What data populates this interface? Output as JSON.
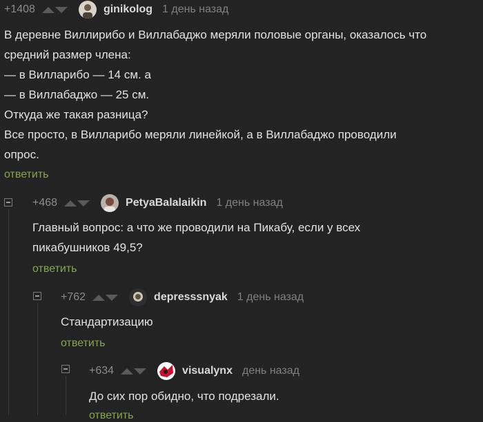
{
  "comments": [
    {
      "rating": "+1408",
      "author": "ginikolog",
      "time": "1 день назад",
      "lines": [
        "В деревне Виллирибо и Виллабаджо меряли половые органы, оказалось что",
        "средний размер члена:",
        "— в Вилларибо — 14 см. а",
        "— в Виллабаджо — 25 см.",
        "Откуда же такая разница?",
        "Все просто, в Вилларибо меряли линейкой, а в Виллабаджо проводили",
        "опрос."
      ],
      "reply": "ответить"
    },
    {
      "rating": "+468",
      "author": "PetyaBalalaikin",
      "time": "1 день назад",
      "lines": [
        "Главный вопрос: а что же проводили на Пикабу, если у всех",
        "пикабушников 49,5?"
      ],
      "reply": "ответить"
    },
    {
      "rating": "+762",
      "author": "depresssnyak",
      "time": "1 день назад",
      "lines": [
        "Стандартизацию"
      ],
      "reply": "ответить"
    },
    {
      "rating": "+634",
      "author": "visualynx",
      "time": "день назад",
      "lines": [
        "До сих пор обидно, что подрезали."
      ],
      "reply": "ответить"
    }
  ],
  "colors": {
    "background": "#232323",
    "text": "#e2e2e2",
    "muted": "#808080",
    "reply_link": "#84a64d",
    "vote_arrow": "#5a5a5a"
  }
}
